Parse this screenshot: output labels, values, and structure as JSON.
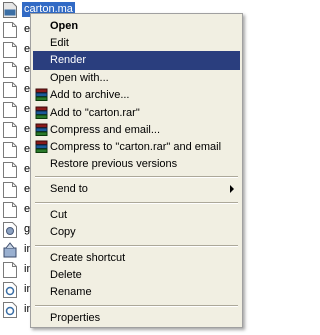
{
  "explorer": {
    "files": [
      {
        "label": "carton.ma",
        "icon": "maya-file-icon",
        "selected": true
      },
      {
        "label": "e",
        "icon": "document-icon"
      },
      {
        "label": "e",
        "icon": "document-icon"
      },
      {
        "label": "e",
        "icon": "document-icon"
      },
      {
        "label": "e",
        "icon": "document-icon"
      },
      {
        "label": "e",
        "icon": "document-icon"
      },
      {
        "label": "e",
        "icon": "document-icon"
      },
      {
        "label": "e",
        "icon": "document-icon"
      },
      {
        "label": "e",
        "icon": "document-icon"
      },
      {
        "label": "e",
        "icon": "document-icon"
      },
      {
        "label": "e",
        "icon": "document-icon"
      },
      {
        "label": "g",
        "icon": "settings-file-icon"
      },
      {
        "label": "in",
        "icon": "installer-icon"
      },
      {
        "label": "in",
        "icon": "document-icon"
      },
      {
        "label": "in",
        "icon": "link-file-icon"
      },
      {
        "label": "in",
        "icon": "link-file-icon"
      }
    ]
  },
  "menu": {
    "open": "Open",
    "edit": "Edit",
    "render": "Render",
    "open_with": "Open with...",
    "add_to_archive": "Add to archive...",
    "add_to_carton_rar": "Add to \"carton.rar\"",
    "compress_and_email": "Compress and email...",
    "compress_to_carton_rar_and_email": "Compress to \"carton.rar\" and email",
    "restore_previous_versions": "Restore previous versions",
    "send_to": "Send to",
    "cut": "Cut",
    "copy": "Copy",
    "create_shortcut": "Create shortcut",
    "delete": "Delete",
    "rename": "Rename",
    "properties": "Properties",
    "highlighted_item": "Render"
  },
  "colors": {
    "menu_background": "#f1efe2",
    "highlight": "#2a3e7e",
    "selection": "#316ac5"
  }
}
